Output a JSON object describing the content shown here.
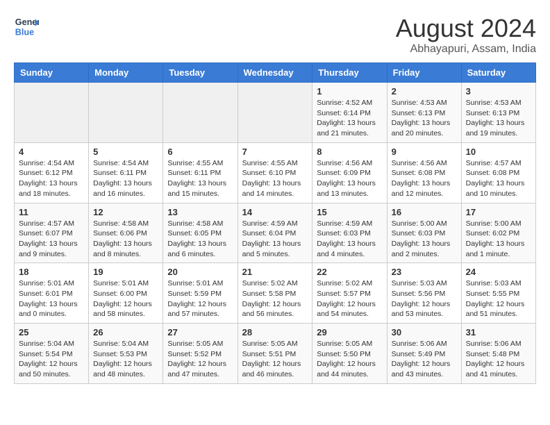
{
  "header": {
    "logo_line1": "General",
    "logo_line2": "Blue",
    "month_year": "August 2024",
    "location": "Abhayapuri, Assam, India"
  },
  "columns": [
    "Sunday",
    "Monday",
    "Tuesday",
    "Wednesday",
    "Thursday",
    "Friday",
    "Saturday"
  ],
  "weeks": [
    [
      {
        "day": "",
        "content": ""
      },
      {
        "day": "",
        "content": ""
      },
      {
        "day": "",
        "content": ""
      },
      {
        "day": "",
        "content": ""
      },
      {
        "day": "1",
        "content": "Sunrise: 4:52 AM\nSunset: 6:14 PM\nDaylight: 13 hours\nand 21 minutes."
      },
      {
        "day": "2",
        "content": "Sunrise: 4:53 AM\nSunset: 6:13 PM\nDaylight: 13 hours\nand 20 minutes."
      },
      {
        "day": "3",
        "content": "Sunrise: 4:53 AM\nSunset: 6:13 PM\nDaylight: 13 hours\nand 19 minutes."
      }
    ],
    [
      {
        "day": "4",
        "content": "Sunrise: 4:54 AM\nSunset: 6:12 PM\nDaylight: 13 hours\nand 18 minutes."
      },
      {
        "day": "5",
        "content": "Sunrise: 4:54 AM\nSunset: 6:11 PM\nDaylight: 13 hours\nand 16 minutes."
      },
      {
        "day": "6",
        "content": "Sunrise: 4:55 AM\nSunset: 6:11 PM\nDaylight: 13 hours\nand 15 minutes."
      },
      {
        "day": "7",
        "content": "Sunrise: 4:55 AM\nSunset: 6:10 PM\nDaylight: 13 hours\nand 14 minutes."
      },
      {
        "day": "8",
        "content": "Sunrise: 4:56 AM\nSunset: 6:09 PM\nDaylight: 13 hours\nand 13 minutes."
      },
      {
        "day": "9",
        "content": "Sunrise: 4:56 AM\nSunset: 6:08 PM\nDaylight: 13 hours\nand 12 minutes."
      },
      {
        "day": "10",
        "content": "Sunrise: 4:57 AM\nSunset: 6:08 PM\nDaylight: 13 hours\nand 10 minutes."
      }
    ],
    [
      {
        "day": "11",
        "content": "Sunrise: 4:57 AM\nSunset: 6:07 PM\nDaylight: 13 hours\nand 9 minutes."
      },
      {
        "day": "12",
        "content": "Sunrise: 4:58 AM\nSunset: 6:06 PM\nDaylight: 13 hours\nand 8 minutes."
      },
      {
        "day": "13",
        "content": "Sunrise: 4:58 AM\nSunset: 6:05 PM\nDaylight: 13 hours\nand 6 minutes."
      },
      {
        "day": "14",
        "content": "Sunrise: 4:59 AM\nSunset: 6:04 PM\nDaylight: 13 hours\nand 5 minutes."
      },
      {
        "day": "15",
        "content": "Sunrise: 4:59 AM\nSunset: 6:03 PM\nDaylight: 13 hours\nand 4 minutes."
      },
      {
        "day": "16",
        "content": "Sunrise: 5:00 AM\nSunset: 6:03 PM\nDaylight: 13 hours\nand 2 minutes."
      },
      {
        "day": "17",
        "content": "Sunrise: 5:00 AM\nSunset: 6:02 PM\nDaylight: 13 hours\nand 1 minute."
      }
    ],
    [
      {
        "day": "18",
        "content": "Sunrise: 5:01 AM\nSunset: 6:01 PM\nDaylight: 13 hours\nand 0 minutes."
      },
      {
        "day": "19",
        "content": "Sunrise: 5:01 AM\nSunset: 6:00 PM\nDaylight: 12 hours\nand 58 minutes."
      },
      {
        "day": "20",
        "content": "Sunrise: 5:01 AM\nSunset: 5:59 PM\nDaylight: 12 hours\nand 57 minutes."
      },
      {
        "day": "21",
        "content": "Sunrise: 5:02 AM\nSunset: 5:58 PM\nDaylight: 12 hours\nand 56 minutes."
      },
      {
        "day": "22",
        "content": "Sunrise: 5:02 AM\nSunset: 5:57 PM\nDaylight: 12 hours\nand 54 minutes."
      },
      {
        "day": "23",
        "content": "Sunrise: 5:03 AM\nSunset: 5:56 PM\nDaylight: 12 hours\nand 53 minutes."
      },
      {
        "day": "24",
        "content": "Sunrise: 5:03 AM\nSunset: 5:55 PM\nDaylight: 12 hours\nand 51 minutes."
      }
    ],
    [
      {
        "day": "25",
        "content": "Sunrise: 5:04 AM\nSunset: 5:54 PM\nDaylight: 12 hours\nand 50 minutes."
      },
      {
        "day": "26",
        "content": "Sunrise: 5:04 AM\nSunset: 5:53 PM\nDaylight: 12 hours\nand 48 minutes."
      },
      {
        "day": "27",
        "content": "Sunrise: 5:05 AM\nSunset: 5:52 PM\nDaylight: 12 hours\nand 47 minutes."
      },
      {
        "day": "28",
        "content": "Sunrise: 5:05 AM\nSunset: 5:51 PM\nDaylight: 12 hours\nand 46 minutes."
      },
      {
        "day": "29",
        "content": "Sunrise: 5:05 AM\nSunset: 5:50 PM\nDaylight: 12 hours\nand 44 minutes."
      },
      {
        "day": "30",
        "content": "Sunrise: 5:06 AM\nSunset: 5:49 PM\nDaylight: 12 hours\nand 43 minutes."
      },
      {
        "day": "31",
        "content": "Sunrise: 5:06 AM\nSunset: 5:48 PM\nDaylight: 12 hours\nand 41 minutes."
      }
    ]
  ]
}
